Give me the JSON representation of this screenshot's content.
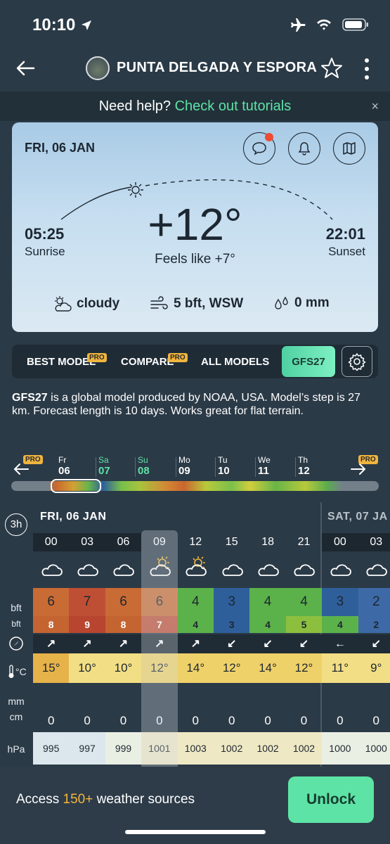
{
  "status": {
    "time": "10:10"
  },
  "header": {
    "station": "PUNTA DELGADA Y ESPORA"
  },
  "help": {
    "prefix": "Need help?",
    "link": "Check out tutorials",
    "close": "×"
  },
  "today": {
    "date": "FRI, 06 JAN",
    "sunrise_time": "05:25",
    "sunrise_label": "Sunrise",
    "sunset_time": "22:01",
    "sunset_label": "Sunset",
    "temp": "+12°",
    "feels": "Feels like +7°",
    "condition": "cloudy",
    "wind": "5 bft, WSW",
    "precip": "0 mm"
  },
  "tabs": {
    "best": "BEST MODEL",
    "compare": "COMPARE",
    "all": "ALL MODELS",
    "active": "GFS27",
    "pro": "PRO"
  },
  "description": {
    "bold": "GFS27",
    "text": " is a global model produced by NOAA, USA. Model’s step is 27 km. Forecast length is 10 days. Works great for flat terrain."
  },
  "days": [
    {
      "dow": "Fr",
      "num": "06",
      "color": "#ffffff"
    },
    {
      "dow": "Sa",
      "num": "07",
      "color": "#5ee3a6"
    },
    {
      "dow": "Su",
      "num": "08",
      "color": "#5ee3a6"
    },
    {
      "dow": "Mo",
      "num": "09",
      "color": "#ffffff"
    },
    {
      "dow": "Tu",
      "num": "10",
      "color": "#ffffff"
    },
    {
      "dow": "We",
      "num": "11",
      "color": "#ffffff"
    },
    {
      "dow": "Th",
      "num": "12",
      "color": "#ffffff"
    }
  ],
  "grid": {
    "step_label": "3h",
    "day1": "FRI, 06 JAN",
    "day2": "SAT, 07 JA",
    "hours": [
      "00",
      "03",
      "06",
      "09",
      "12",
      "15",
      "18",
      "21",
      "00",
      "03"
    ],
    "bft": [
      "6",
      "7",
      "6",
      "6",
      "4",
      "3",
      "4",
      "4",
      "3",
      "2"
    ],
    "gust": [
      "8",
      "9",
      "8",
      "7",
      "4",
      "3",
      "4",
      "5",
      "4",
      "2"
    ],
    "dir": [
      "↗",
      "↗",
      "↗",
      "↗",
      "↗",
      "↙",
      "↙",
      "↙",
      "←",
      "↙"
    ],
    "temp": [
      "15°",
      "10°",
      "10°",
      "12°",
      "14°",
      "12°",
      "14°",
      "12°",
      "11°",
      "9°"
    ],
    "precip": [
      "0",
      "0",
      "0",
      "0",
      "0",
      "0",
      "0",
      "0",
      "0",
      "0"
    ],
    "hpa": [
      "995",
      "997",
      "999",
      "1001",
      "1003",
      "1002",
      "1002",
      "1002",
      "1000",
      "1000"
    ],
    "labels": {
      "bft": "bft",
      "gust": "bft",
      "temp": "°C",
      "precip_1": "mm",
      "precip_2": "cm",
      "hpa": "hPa"
    }
  },
  "bottom": {
    "prefix": "Access ",
    "highlight": "150+",
    "suffix": " weather sources",
    "button": "Unlock"
  }
}
